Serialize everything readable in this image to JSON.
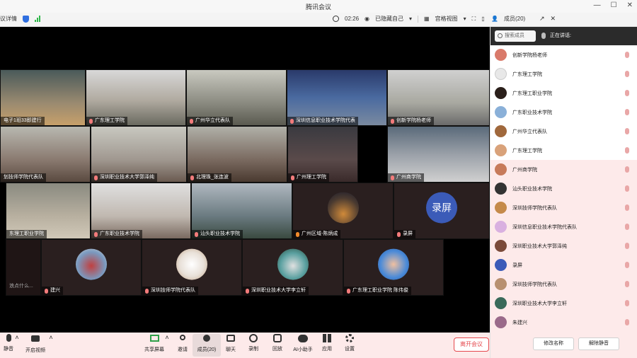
{
  "app": {
    "title": "腾讯会议"
  },
  "toolbar": {
    "meeting_info": "议详情",
    "timer": "02:26",
    "hidden_self": "已隐藏自己",
    "view_mode": "宫格视图",
    "members_label": "成员(20)"
  },
  "tiles_row1": [
    "电子1班33即建行",
    "广东理工学院",
    "广州华立代表队",
    "深圳信息职业技术学院代表",
    "创新学院杨老师"
  ],
  "tiles_row2": [
    "划技师学院代表队",
    "深圳职业技术大学郭泽纯",
    "北理珠_张连波",
    "广州理工学院",
    "广州商学院"
  ],
  "tiles_row3": [
    "东理工职业学院",
    "广东职业技术学院",
    "汕头职业技术学院",
    "广州区域-陈炳成",
    "录屏"
  ],
  "tiles_row4": [
    "浪点什么...",
    "建兴",
    "深圳技师学院代表队",
    "深圳职业技术大学李立轩",
    "广东理工职业学院 陈伟俊"
  ],
  "record_tile_text": "录屏",
  "controls": {
    "mute": "静音",
    "video": "开启视频",
    "share": "共享屏幕",
    "invite": "邀请",
    "members": "成员(20)",
    "chat": "聊天",
    "record": "录制",
    "replay": "回放",
    "ai": "AI小助手",
    "apps": "应用",
    "settings": "设置",
    "leave": "离开会议"
  },
  "panel": {
    "search_placeholder": "搜索成员",
    "speaking_label": "正在讲话:",
    "members": [
      {
        "name": "创新学院杨老师",
        "color": "#d97a6a"
      },
      {
        "name": "广东理工学院",
        "color": "#e8e8e8"
      },
      {
        "name": "广东理工职业学院",
        "color": "#2a1f1a"
      },
      {
        "name": "广东职业技术学院",
        "color": "#8ab0d8"
      },
      {
        "name": "广州华立代表队",
        "color": "#a0683c"
      },
      {
        "name": "广东理工学院",
        "color": "#d9a27a"
      },
      {
        "name": "广州商学院",
        "color": "#c77a5a"
      },
      {
        "name": "汕头职业技术学院",
        "color": "#333333"
      },
      {
        "name": "深圳技师学院代表队",
        "color": "#c58a4a"
      },
      {
        "name": "深圳信息职业技术学院代表队",
        "color": "#d9b0e0"
      },
      {
        "name": "深圳职业技术大学郭泽纯",
        "color": "#7a4a3a"
      },
      {
        "name": "录屏",
        "color": "#3b5bb8"
      },
      {
        "name": "深圳技师学院代表队",
        "color": "#b89070"
      },
      {
        "name": "深圳职业技术大学李立轩",
        "color": "#3a6a5a"
      },
      {
        "name": "朱建兴",
        "color": "#9a6a8a"
      }
    ],
    "rename_btn": "修改名称",
    "unmute_btn": "解除静音"
  }
}
